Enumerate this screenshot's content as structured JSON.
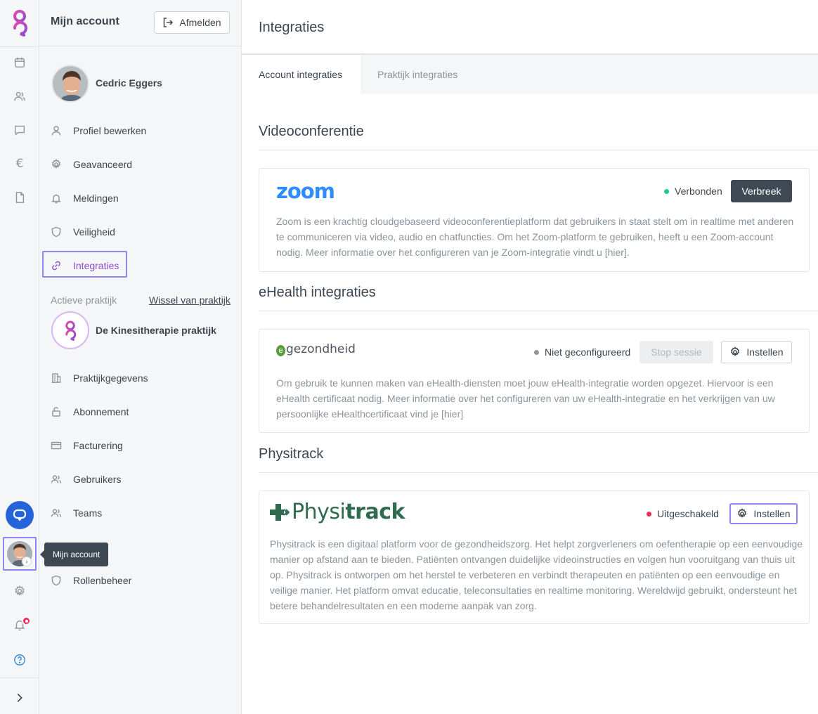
{
  "rail": {
    "tooltip": "Mijn account"
  },
  "sidebar": {
    "title": "Mijn account",
    "logout_label": "Afmelden",
    "user_name": "Cedric Eggers",
    "account_items": [
      {
        "label": "Profiel bewerken",
        "icon": "user-icon"
      },
      {
        "label": "Geavanceerd",
        "icon": "gear-icon"
      },
      {
        "label": "Meldingen",
        "icon": "bell-icon"
      },
      {
        "label": "Veiligheid",
        "icon": "shield-icon"
      },
      {
        "label": "Integraties",
        "icon": "link-icon",
        "active": true
      }
    ],
    "active_practice_label": "Actieve praktijk",
    "switch_practice_label": "Wissel van praktijk",
    "practice_name": "De Kinesitherapie praktijk",
    "practice_items": [
      {
        "label": "Praktijkgegevens",
        "icon": "building-icon"
      },
      {
        "label": "Abonnement",
        "icon": "lock-icon"
      },
      {
        "label": "Facturering",
        "icon": "credit-card-icon"
      },
      {
        "label": "Gebruikers",
        "icon": "users-icon"
      },
      {
        "label": "Teams",
        "icon": "users-icon"
      },
      {
        "label": "Rollenbeheer",
        "icon": "shield-icon"
      }
    ]
  },
  "main": {
    "title": "Integraties",
    "tabs": [
      {
        "label": "Account integraties",
        "active": true
      },
      {
        "label": "Praktijk integraties",
        "active": false
      }
    ],
    "sections": {
      "video": {
        "title": "Videoconferentie",
        "zoom": {
          "logo": "zoom",
          "status": "Verbonden",
          "status_color": "#1ec99a",
          "disconnect_label": "Verbreek",
          "description": "Zoom is een krachtig cloudgebaseerd videoconferentieplatform dat gebruikers in staat stelt om in realtime met anderen te communiceren via video, audio en chatfuncties. Om het Zoom-platform te gebruiken, heeft u een Zoom-account nodig. Meer informatie over het configureren van je Zoom-integratie vindt u [hier]."
        }
      },
      "ehealth": {
        "title": "eHealth integraties",
        "egezondheid": {
          "logo_e": "e",
          "logo_text": "gezondheid",
          "status": "Niet geconfigureerd",
          "status_color": "#8b949c",
          "stop_label": "Stop sessie",
          "settings_label": "Instellen",
          "description": "Om gebruik te kunnen maken van eHealth-diensten moet jouw eHealth-integratie worden opgezet. Hiervoor is een eHealth certificaat nodig. Meer informatie over het configureren van uw eHealth-integratie en het verkrijgen van uw persoonlijke eHealthcertificaat vind je [hier]"
        }
      },
      "physitrack": {
        "title": "Physitrack",
        "card": {
          "logo_part1": "Physi",
          "logo_part2": "track",
          "status": "Uitgeschakeld",
          "status_color": "#ee2b5b",
          "settings_label": "Instellen",
          "description": "Physitrack is een digitaal platform voor de gezondheidszorg. Het helpt zorgverleners om oefentherapie op een eenvoudige manier op afstand aan te bieden. Patiënten ontvangen duidelijke videoinstructies en volgen hun vooruitgang van thuis uit op. Physitrack is ontworpen om het herstel te verbeteren en verbindt therapeuten en patiënten op een eenvoudige en veilige manier. Het platform omvat educatie, teleconsultaties en realtime monitoring. Wereldwijd gebruikt, ondersteunt het betere behandelresultaten en een moderne aanpak van zorg."
        }
      }
    }
  },
  "colors": {
    "accent_purple": "#8e4ec6",
    "highlight": "#8f87f1",
    "zoom_blue": "#2d8cff",
    "physitrack_green": "#2f6b4f",
    "chat_blue": "#2563d8"
  }
}
